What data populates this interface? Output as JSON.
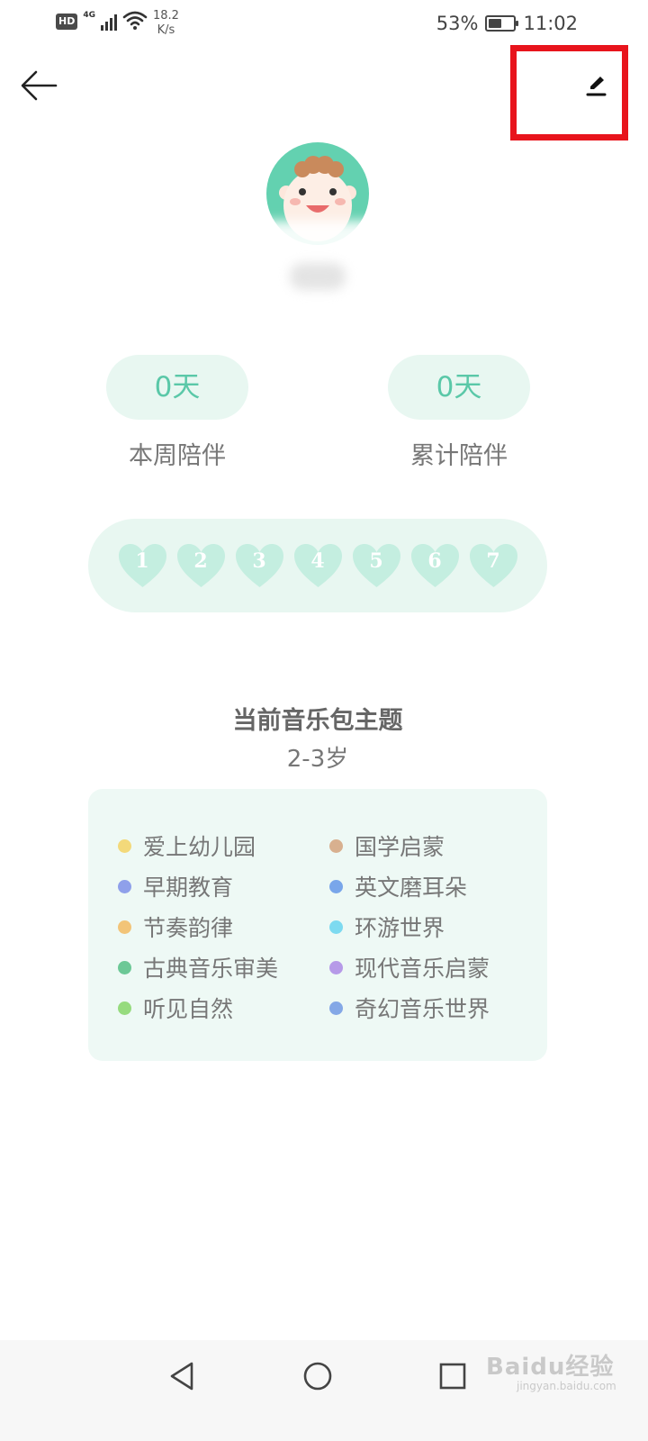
{
  "status_bar": {
    "hd": "HD",
    "network": "4G",
    "speed_value": "18.2",
    "speed_unit": "K/s",
    "battery_percent": "53%",
    "battery_level": 0.53,
    "time": "11:02"
  },
  "stats": [
    {
      "value": "0天",
      "label": "本周陪伴"
    },
    {
      "value": "0天",
      "label": "累计陪伴"
    }
  ],
  "hearts": [
    "1",
    "2",
    "3",
    "4",
    "5",
    "6",
    "7"
  ],
  "theme": {
    "title": "当前音乐包主题",
    "age": "2-3岁",
    "items": [
      {
        "label": "爱上幼儿园",
        "color": "#f3d97a"
      },
      {
        "label": "国学启蒙",
        "color": "#d8b08f"
      },
      {
        "label": "早期教育",
        "color": "#8fa0ea"
      },
      {
        "label": "英文磨耳朵",
        "color": "#79a6ea"
      },
      {
        "label": "节奏韵律",
        "color": "#f2c478"
      },
      {
        "label": "环游世界",
        "color": "#7ddaf0"
      },
      {
        "label": "古典音乐审美",
        "color": "#6cc896"
      },
      {
        "label": "现代音乐启蒙",
        "color": "#b69ae8"
      },
      {
        "label": "听见自然",
        "color": "#96db7e"
      },
      {
        "label": "奇幻音乐世界",
        "color": "#84a8e6"
      }
    ]
  },
  "colors": {
    "accent": "#5ac8a8",
    "accent_light": "#e8f7f1",
    "heart": "#c4eee0",
    "highlight_box": "#e8141c",
    "avatar_bg": "#63d1b0"
  },
  "icons": {
    "back": "arrow-left-icon",
    "edit": "pencil-icon",
    "nav_back": "triangle-back-icon",
    "nav_home": "circle-home-icon",
    "nav_recent": "square-recent-icon"
  },
  "watermark": {
    "main": "Baidu经验",
    "sub": "jingyan.baidu.com"
  }
}
